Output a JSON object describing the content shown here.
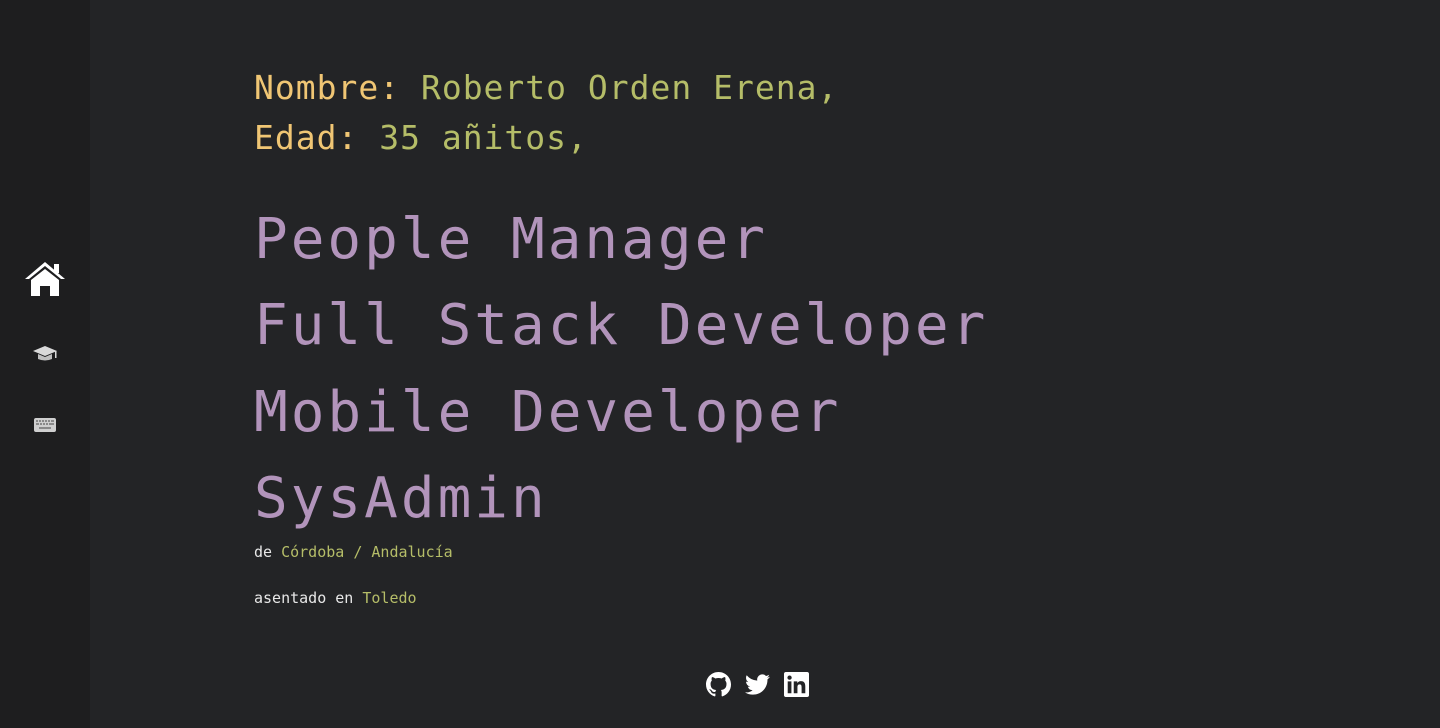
{
  "profile": {
    "name_key": "Nombre:",
    "name_value": "Roberto Orden Erena",
    "age_key": "Edad:",
    "age_value": "35 añitos",
    "separator": ","
  },
  "roles": [
    "People Manager",
    "Full Stack Developer",
    "Mobile Developer",
    "SysAdmin"
  ],
  "location": {
    "from_prefix": "de",
    "from_value": "Córdoba / Andalucía",
    "based_prefix": "asentado en",
    "based_value": "Toledo"
  },
  "nav": [
    {
      "icon": "home-icon"
    },
    {
      "icon": "graduation-cap-icon"
    },
    {
      "icon": "keyboard-icon"
    }
  ],
  "social": [
    {
      "icon": "github-icon"
    },
    {
      "icon": "twitter-icon"
    },
    {
      "icon": "linkedin-icon"
    }
  ],
  "colors": {
    "background": "#232426",
    "sidebar": "#1e1e1f",
    "key": "#f0c674",
    "value": "#b5bd68",
    "role": "#b294bb",
    "text": "#e8e8e8"
  }
}
